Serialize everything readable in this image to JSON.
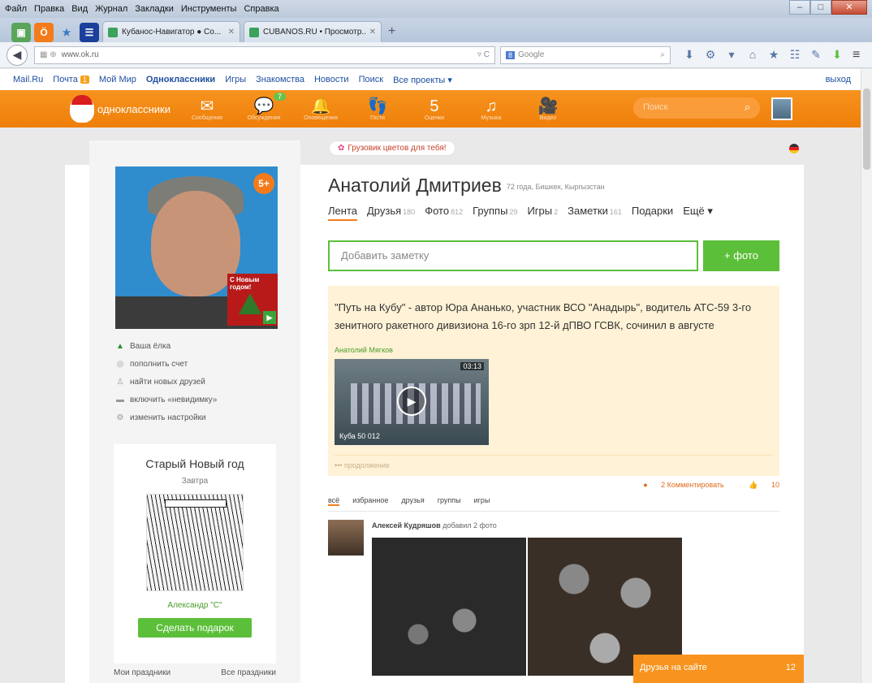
{
  "browser": {
    "menu": [
      "Файл",
      "Правка",
      "Вид",
      "Журнал",
      "Закладки",
      "Инструменты",
      "Справка"
    ],
    "tabs": [
      {
        "title": "Кубанос-Навигатор ● Co..."
      },
      {
        "title": "CUBANOS.RU • Просмотр..."
      }
    ],
    "url": "www.ok.ru",
    "search_placeholder": "Google",
    "search_engine": "8"
  },
  "mailbar": {
    "links": [
      "Mail.Ru",
      "Почта",
      "Мой Мир",
      "Одноклассники",
      "Игры",
      "Знакомства",
      "Новости",
      "Поиск",
      "Все проекты ▾"
    ],
    "mail_badge": "1",
    "logout": "выход"
  },
  "okbar": {
    "logo": "одноклассники",
    "nav": [
      {
        "icon": "envelope-icon",
        "label": "Сообщения",
        "glyph": "✉",
        "count": ""
      },
      {
        "icon": "discussions-icon",
        "label": "Обсуждения",
        "glyph": "💬",
        "count": "7"
      },
      {
        "icon": "bell-icon",
        "label": "Оповещения",
        "glyph": "🔔",
        "count": ""
      },
      {
        "icon": "guests-icon",
        "label": "Гости",
        "glyph": "👣",
        "count": ""
      },
      {
        "icon": "rating-icon",
        "label": "Оценки",
        "glyph": "5",
        "count": ""
      },
      {
        "icon": "music-icon",
        "label": "Музыка",
        "glyph": "♫",
        "count": ""
      },
      {
        "icon": "video-icon",
        "label": "Видео",
        "glyph": "🎥",
        "count": ""
      }
    ],
    "search_placeholder": "Поиск"
  },
  "banner": "Грузовик цветов для тебя!",
  "profile": {
    "age_badge": "5+",
    "card_text": "С Новым годом!",
    "name": "Анатолий Дмитриев",
    "meta": "72 года, Бишкек, Кыргызстан",
    "tabs": [
      {
        "label": "Лента",
        "num": ""
      },
      {
        "label": "Друзья",
        "num": "180"
      },
      {
        "label": "Фото",
        "num": "812"
      },
      {
        "label": "Группы",
        "num": "29"
      },
      {
        "label": "Игры",
        "num": "2"
      },
      {
        "label": "Заметки",
        "num": "161"
      },
      {
        "label": "Подарки",
        "num": ""
      },
      {
        "label": "Ещё ▾",
        "num": ""
      }
    ],
    "menu": [
      {
        "icon": "tree-icon",
        "label": "Ваша ёлка"
      },
      {
        "icon": "coin-icon",
        "label": "пополнить счет"
      },
      {
        "icon": "person-icon",
        "label": "найти новых друзей"
      },
      {
        "icon": "invisible-icon",
        "label": "включить «невидимку»"
      },
      {
        "icon": "gear-icon",
        "label": "изменить настройки"
      }
    ]
  },
  "holiday": {
    "title": "Старый Новый год",
    "when": "Завтра",
    "who": "Александр \"С\"",
    "button": "Сделать подарок",
    "link_left": "Мои праздники",
    "link_right": "Все праздники"
  },
  "note": {
    "placeholder": "Добавить заметку",
    "photo_button": "фото"
  },
  "post": {
    "text": "\"Путь на Кубу\" - автор Юра Ананько, участник ВСО \"Анадырь\", водитель АТС-59 3-го зенитного ракетного дивизиона 16-го зрп 12-й дПВО ГСВК, сочинил в августе",
    "author": "Анатолий Мягков",
    "video_duration": "03:13",
    "video_caption": "Куба 50 012",
    "more": "••• продолжение",
    "comments": "2 Комментировать",
    "likes": "10"
  },
  "filters": [
    "всё",
    "избранное",
    "друзья",
    "группы",
    "игры"
  ],
  "feed": {
    "author": "Алексей Кудряшов",
    "action": "добавил 2 фото"
  },
  "online": {
    "label": "Друзья на сайте",
    "count": "12"
  }
}
